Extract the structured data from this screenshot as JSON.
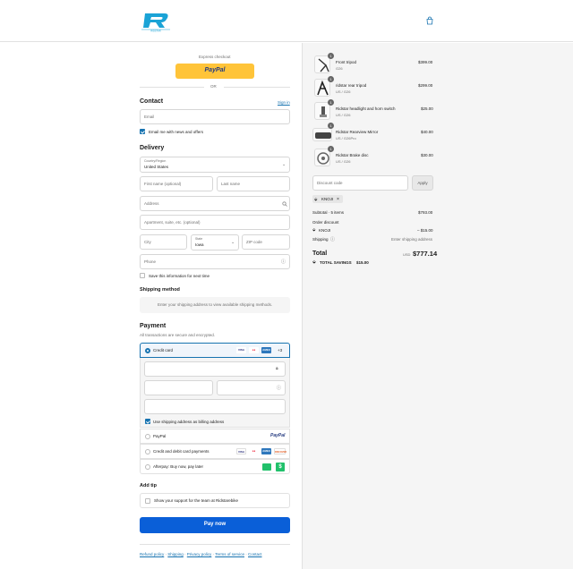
{
  "header": {
    "logo_text": "RIDSTAR",
    "cart_icon": "shopping-bag-icon"
  },
  "express": {
    "label": "Express checkout",
    "paypal_label": "PayPal",
    "or_label": "OR"
  },
  "contact": {
    "title": "Contact",
    "sign_in": "Sign in",
    "email_placeholder": "Email",
    "news_label": "Email me with news and offers"
  },
  "delivery": {
    "title": "Delivery",
    "country_label": "Country/Region",
    "country_value": "United States",
    "first_name": "First name (optional)",
    "last_name": "Last name",
    "address": "Address",
    "apartment": "Apartment, suite, etc. (optional)",
    "city": "City",
    "state_label": "State",
    "state_value": "Iowa",
    "zip": "ZIP code",
    "phone": "Phone",
    "save_info": "Save this information for next time"
  },
  "shipping_method": {
    "title": "Shipping method",
    "message": "Enter your shipping address to view available shipping methods."
  },
  "payment": {
    "title": "Payment",
    "subtitle": "All transactions are secure and encrypted.",
    "credit_card": "Credit card",
    "more_cards": "+3",
    "billing_same": "Use shipping address as billing address",
    "paypal": "PayPal",
    "paypal_logo": "PayPal",
    "debit": "Credit and debit card payments",
    "afterpay": "Afterpay: Buy now, pay later",
    "card_logos": [
      "VISA",
      "MC",
      "AMEX",
      "DISCOVER"
    ]
  },
  "tip": {
    "title": "Add tip",
    "label": "Show your support for the team at Ridstarebike"
  },
  "pay_button": "Pay now",
  "footer_links": [
    "Refund policy",
    "Shipping",
    "Privacy policy",
    "Terms of service",
    "Contact"
  ],
  "items": [
    {
      "name": "Front tripod",
      "variant": "G26",
      "price": "$399.00",
      "qty": "1"
    },
    {
      "name": "ridstar rear tripod",
      "variant": "US / G26",
      "price": "$299.00",
      "qty": "1"
    },
    {
      "name": "Ridstar headlight and horn switch",
      "variant": "US / G26",
      "price": "$25.00",
      "qty": "1"
    },
    {
      "name": "Ridstar Rearview Mirror",
      "variant": "US / G26Pro",
      "price": "$40.00",
      "qty": "1"
    },
    {
      "name": "Ridstar Brake disc",
      "variant": "US / G26",
      "price": "$30.00",
      "qty": "1"
    }
  ],
  "discount": {
    "placeholder": "Discount code",
    "apply": "Apply",
    "tag": "KNOJI"
  },
  "summary": {
    "subtotal_label": "Subtotal · 5 items",
    "subtotal_value": "$793.00",
    "order_discount": "Order discount",
    "code": "KNOJI",
    "code_value": "– $15.00",
    "shipping_label": "Shipping",
    "shipping_value": "Enter shipping address",
    "total_label": "Total",
    "currency": "USD",
    "total_value": "$777.14",
    "savings_label": "TOTAL SAVINGS",
    "savings_value": "$15.00"
  }
}
